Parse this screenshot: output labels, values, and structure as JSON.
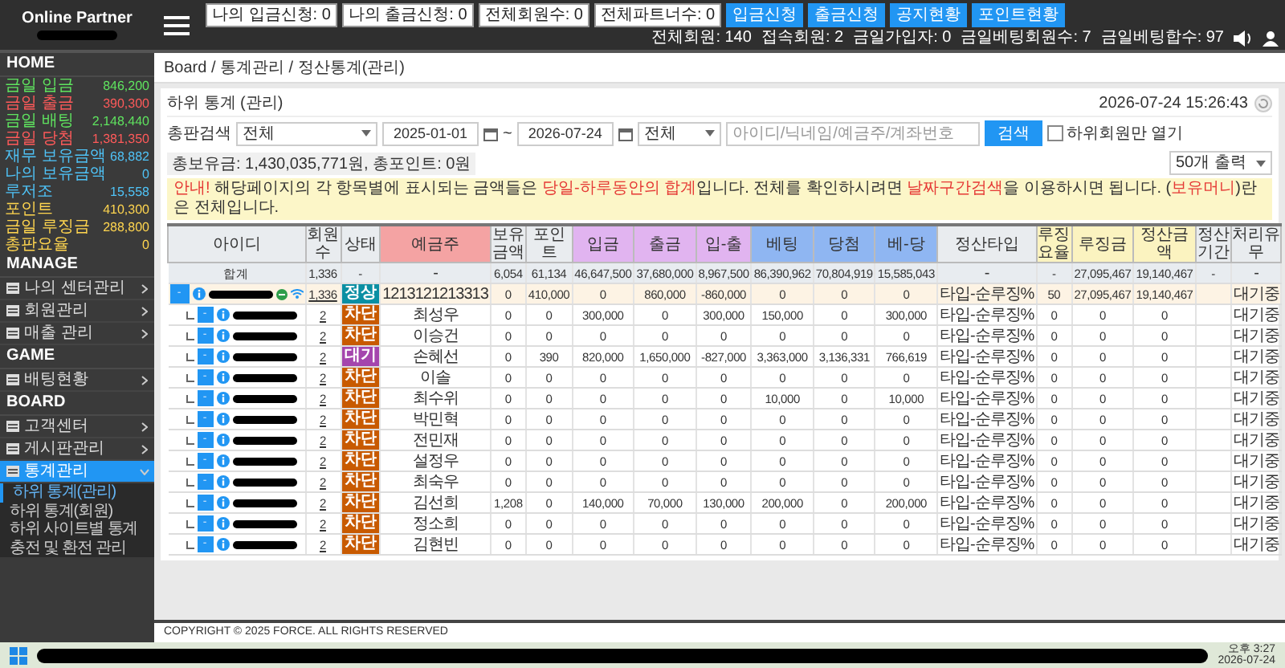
{
  "header": {
    "logo": "Online Partner",
    "quick_buttons": [
      {
        "label": "나의 입금신청: 0",
        "kind": "outline"
      },
      {
        "label": "나의 출금신청: 0",
        "kind": "outline"
      },
      {
        "label": "전체회원수: 0",
        "kind": "outline"
      },
      {
        "label": "전체파트너수: 0",
        "kind": "outline"
      },
      {
        "label": "입금신청",
        "kind": "primary"
      },
      {
        "label": "출금신청",
        "kind": "primary"
      },
      {
        "label": "공지현황",
        "kind": "primary"
      },
      {
        "label": "포인트현황",
        "kind": "primary"
      }
    ],
    "stats": [
      "전체회원: 140",
      "접속회원: 2",
      "금일가입자: 0",
      "금일베팅회원수: 7",
      "금일베팅합수: 97"
    ]
  },
  "sidebar": {
    "summary_title": "HOME",
    "summary": [
      {
        "label": "금일 입금",
        "value": "846,200",
        "color": "#5fe35f"
      },
      {
        "label": "금일 출금",
        "value": "390,300",
        "color": "#ff5a5a"
      },
      {
        "label": "금일 배팅",
        "value": "2,148,440",
        "color": "#5fe35f"
      },
      {
        "label": "금일 당첨",
        "value": "1,381,350",
        "color": "#ff5a5a"
      },
      {
        "label": "재무 보유금액",
        "value": "68,882",
        "color": "#4fc3f7"
      },
      {
        "label": "나의 보유금액",
        "value": "0",
        "color": "#4fc3f7"
      },
      {
        "label": "루저조",
        "value": "15,558",
        "color": "#4fc3f7"
      },
      {
        "label": "포인트",
        "value": "410,300",
        "color": "#ffd54f"
      },
      {
        "label": "금일 루징금",
        "value": "288,800",
        "color": "#ffd54f"
      },
      {
        "label": "총판요율",
        "value": "0",
        "color": "#ffd54f"
      }
    ],
    "sections": [
      {
        "title": "MANAGE",
        "items": [
          {
            "label": "나의 센터관리",
            "selected": false,
            "expanded": false
          },
          {
            "label": "회원관리",
            "selected": false,
            "expanded": false
          },
          {
            "label": "매출 관리",
            "selected": false,
            "expanded": false
          }
        ]
      },
      {
        "title": "GAME",
        "items": [
          {
            "label": "배팅현황",
            "selected": false,
            "expanded": false
          }
        ]
      },
      {
        "title": "BOARD",
        "items": [
          {
            "label": "고객센터",
            "selected": false,
            "expanded": false
          },
          {
            "label": "게시판관리",
            "selected": false,
            "expanded": false
          },
          {
            "label": "통계관리",
            "selected": true,
            "expanded": true,
            "children": [
              {
                "label": "하위 통계(관리)",
                "selected": true
              },
              {
                "label": "하위 통계(회원)",
                "selected": false
              },
              {
                "label": "하위 사이트별 통계",
                "selected": false
              },
              {
                "label": "충전 및 환전 관리",
                "selected": false
              }
            ]
          }
        ]
      }
    ]
  },
  "breadcrumb": "Board / 통계관리 / 정산통계(관리)",
  "panel": {
    "title": "하위 통계 (관리)",
    "timestamp": "2026-07-24 15:26:43",
    "filters": {
      "label": "총판검색",
      "type_select": "전체",
      "date_from": "2025-01-01",
      "separator": "~",
      "date_to": "2026-07-24",
      "range_select": "전체",
      "search": {
        "placeholder": "아이디/닉네임/예금주/계좌번호"
      },
      "search_button": "검색",
      "checkbox": {
        "label": "하위회원만 열기",
        "checked": false
      },
      "totals": "총보유금: 1,430,035,771원, 총포인트: 0원",
      "page_size": "50개 출력"
    },
    "notice": [
      {
        "text": "안내!",
        "highlight": true
      },
      {
        "text": " 해당페이지의 각 항목별에 표시되는 금액들은 ",
        "highlight": false
      },
      {
        "text": "당일-하루동안의 합계",
        "highlight": true
      },
      {
        "text": "입니다. 전체를 확인하시려면 ",
        "highlight": false
      },
      {
        "text": "날짜구간검색",
        "highlight": true
      },
      {
        "text": "을 이용하시면 됩니다. (",
        "highlight": false
      },
      {
        "text": "보유머니",
        "highlight": true
      },
      {
        "text": ")란은 전체입니다.",
        "highlight": false
      }
    ],
    "table": {
      "columns": [
        {
          "label": "아이디",
          "color": "#e9ecef"
        },
        {
          "label": "회원수",
          "color": "#e9ecef"
        },
        {
          "label": "상태",
          "color": "#e9ecef"
        },
        {
          "label": "예금주",
          "color": "#f4a3a3"
        },
        {
          "label": "보유금액",
          "color": "#e9ecef"
        },
        {
          "label": "포인트",
          "color": "#e9ecef"
        },
        {
          "label": "입금",
          "color": "#e1b4f0"
        },
        {
          "label": "출금",
          "color": "#e1b4f0"
        },
        {
          "label": "입-출",
          "color": "#e1b4f0"
        },
        {
          "label": "베팅",
          "color": "#8fb6f2"
        },
        {
          "label": "당첨",
          "color": "#8fb6f2"
        },
        {
          "label": "베-당",
          "color": "#8fb6f2"
        },
        {
          "label": "정산타입",
          "color": "#e9ecef"
        },
        {
          "label": "루징요율",
          "color": "#fbf3c0"
        },
        {
          "label": "루징금",
          "color": "#fbf3c0"
        },
        {
          "label": "정산금액",
          "color": "#fbf3c0"
        },
        {
          "label": "정산기간",
          "color": "#e9ecef"
        },
        {
          "label": "처리유무",
          "color": "#e9ecef"
        }
      ],
      "summary": {
        "label": "합계",
        "members": "1,336",
        "status": "-",
        "holder": "-",
        "values": [
          "6,054",
          "61,134",
          "46,647,500",
          "37,680,000",
          "8,967,500",
          "86,390,962",
          "70,804,919",
          "15,585,043"
        ],
        "settle_type": "-",
        "losing_rate": "-",
        "losing_amount": "27,095,467",
        "settle_amount": "19,140,467",
        "period": "-",
        "process": "-"
      },
      "rows": [
        {
          "toggle": "-",
          "online": true,
          "members": "1,336",
          "status": {
            "label": "정상",
            "kind": "normal"
          },
          "holder": "1213121213313",
          "values": [
            "0",
            "410,000",
            "0",
            "860,000",
            "-860,000",
            "0",
            "0",
            "0"
          ],
          "settle_type": "타입-순루징%",
          "losing_rate": "50",
          "losing_amount": "27,095,467",
          "settle_amount": "19,140,467",
          "process": "대기중",
          "children": [
            {
              "toggle": "-",
              "online": false,
              "members": "2",
              "status": {
                "label": "차단",
                "kind": "blocked"
              },
              "holder": "최성우",
              "values": [
                "0",
                "0",
                "300,000",
                "0",
                "300,000",
                "150,000",
                "0",
                "300,000"
              ],
              "settle_type": "타입-순루징%",
              "losing_rate": "0",
              "losing_amount": "0",
              "settle_amount": "0",
              "process": "대기중"
            },
            {
              "toggle": "-",
              "online": false,
              "members": "2",
              "status": {
                "label": "차단",
                "kind": "blocked"
              },
              "holder": "이승건",
              "values": [
                "0",
                "0",
                "0",
                "0",
                "0",
                "0",
                "0",
                "0"
              ],
              "settle_type": "타입-순루징%",
              "losing_rate": "0",
              "losing_amount": "0",
              "settle_amount": "0",
              "process": "대기중"
            },
            {
              "toggle": "-",
              "online": false,
              "members": "2",
              "status": {
                "label": "대기",
                "kind": "waiting"
              },
              "holder": "손혜선",
              "values": [
                "0",
                "390",
                "820,000",
                "1,650,000",
                "-827,000",
                "3,363,000",
                "3,136,331",
                "766,619"
              ],
              "settle_type": "타입-순루징%",
              "losing_rate": "0",
              "losing_amount": "0",
              "settle_amount": "0",
              "process": "대기중"
            },
            {
              "toggle": "-",
              "online": false,
              "members": "2",
              "status": {
                "label": "차단",
                "kind": "blocked"
              },
              "holder": "이솔",
              "values": [
                "0",
                "0",
                "0",
                "0",
                "0",
                "0",
                "0",
                "0"
              ],
              "settle_type": "타입-순루징%",
              "losing_rate": "0",
              "losing_amount": "0",
              "settle_amount": "0",
              "process": "대기중"
            },
            {
              "toggle": "-",
              "online": false,
              "members": "2",
              "status": {
                "label": "차단",
                "kind": "blocked"
              },
              "holder": "최수위",
              "values": [
                "0",
                "0",
                "0",
                "0",
                "0",
                "10,000",
                "0",
                "10,000"
              ],
              "settle_type": "타입-순루징%",
              "losing_rate": "0",
              "losing_amount": "0",
              "settle_amount": "0",
              "process": "대기중"
            },
            {
              "toggle": "-",
              "online": false,
              "members": "2",
              "status": {
                "label": "차단",
                "kind": "blocked"
              },
              "holder": "박민혁",
              "values": [
                "0",
                "0",
                "0",
                "0",
                "0",
                "0",
                "0",
                "0"
              ],
              "settle_type": "타입-순루징%",
              "losing_rate": "0",
              "losing_amount": "0",
              "settle_amount": "0",
              "process": "대기중"
            },
            {
              "toggle": "-",
              "online": false,
              "members": "2",
              "status": {
                "label": "차단",
                "kind": "blocked"
              },
              "holder": "전민재",
              "values": [
                "0",
                "0",
                "0",
                "0",
                "0",
                "0",
                "0",
                "0"
              ],
              "settle_type": "타입-순루징%",
              "losing_rate": "0",
              "losing_amount": "0",
              "settle_amount": "0",
              "process": "대기중"
            },
            {
              "toggle": "-",
              "online": false,
              "members": "2",
              "status": {
                "label": "차단",
                "kind": "blocked"
              },
              "holder": "설정우",
              "values": [
                "0",
                "0",
                "0",
                "0",
                "0",
                "0",
                "0",
                "0"
              ],
              "settle_type": "타입-순루징%",
              "losing_rate": "0",
              "losing_amount": "0",
              "settle_amount": "0",
              "process": "대기중"
            },
            {
              "toggle": "-",
              "online": false,
              "members": "2",
              "status": {
                "label": "차단",
                "kind": "blocked"
              },
              "holder": "최숙우",
              "values": [
                "0",
                "0",
                "0",
                "0",
                "0",
                "0",
                "0",
                "0"
              ],
              "settle_type": "타입-순루징%",
              "losing_rate": "0",
              "losing_amount": "0",
              "settle_amount": "0",
              "process": "대기중"
            },
            {
              "toggle": "-",
              "online": false,
              "members": "2",
              "status": {
                "label": "차단",
                "kind": "blocked"
              },
              "holder": "김선희",
              "values": [
                "1,208",
                "0",
                "140,000",
                "70,000",
                "130,000",
                "200,000",
                "0",
                "200,000"
              ],
              "settle_type": "타입-순루징%",
              "losing_rate": "0",
              "losing_amount": "0",
              "settle_amount": "0",
              "process": "대기중"
            },
            {
              "toggle": "-",
              "online": false,
              "members": "2",
              "status": {
                "label": "차단",
                "kind": "blocked"
              },
              "holder": "정소희",
              "values": [
                "0",
                "0",
                "0",
                "0",
                "0",
                "0",
                "0",
                "0"
              ],
              "settle_type": "타입-순루징%",
              "losing_rate": "0",
              "losing_amount": "0",
              "settle_amount": "0",
              "process": "대기중"
            },
            {
              "toggle": "-",
              "online": false,
              "members": "2",
              "status": {
                "label": "차단",
                "kind": "blocked"
              },
              "holder": "김현빈",
              "values": [
                "0",
                "0",
                "0",
                "0",
                "0",
                "0",
                "0",
                "0"
              ],
              "settle_type": "타입-순루징%",
              "losing_rate": "0",
              "losing_amount": "0",
              "settle_amount": "0",
              "process": "대기중"
            }
          ]
        }
      ]
    }
  },
  "footer": "COPYRIGHT © 2025 FORCE. ALL RIGHTS RESERVED",
  "taskbar": {
    "time": "오후 3:27",
    "date": "2026-07-24"
  }
}
